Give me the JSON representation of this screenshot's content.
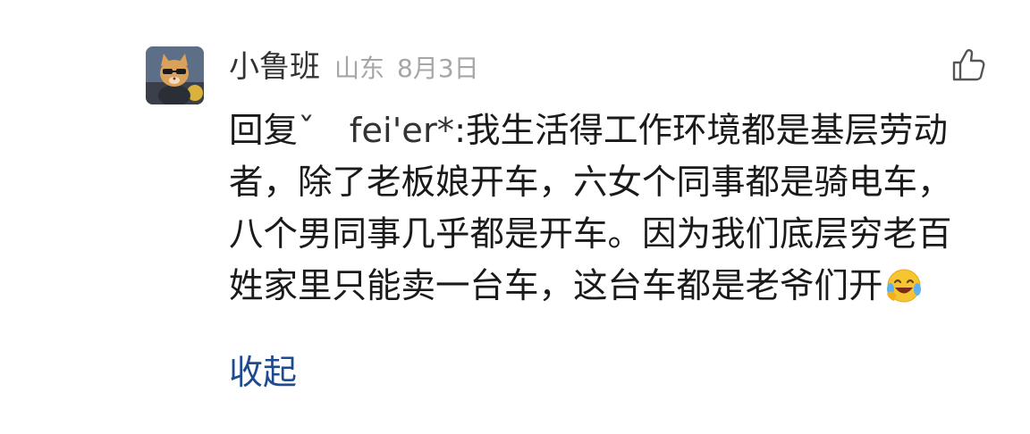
{
  "comment": {
    "username": "小鲁班",
    "location": "山东",
    "date": "8月3日",
    "reply_prefix": "回复",
    "reply_target": "ˇ　fei'er*",
    "reply_separator": ":",
    "content": "我生活得工作环境都是基层劳动者，除了老板娘开车，六女个同事都是骑电车，八个男同事几乎都是开车。因为我们底层穷老百姓家里只能卖一台车，这台车都是老爷们开",
    "emoji": "laughing-crying-emoji",
    "collapse_label": "收起",
    "like_icon": "thumbs-up-icon",
    "avatar": "cat-avatar"
  },
  "colors": {
    "username": "#333333",
    "meta": "#a6a6a6",
    "text": "#1a1a1a",
    "link": "#1e4a8f"
  }
}
